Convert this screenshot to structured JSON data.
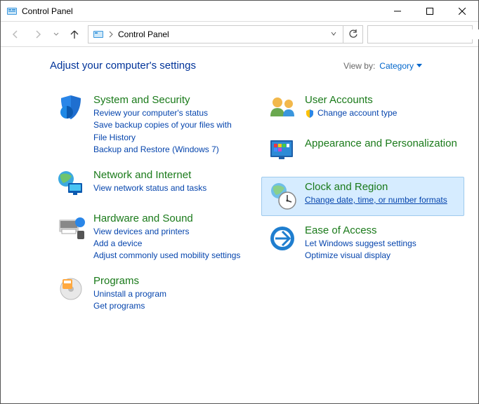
{
  "window": {
    "title": "Control Panel"
  },
  "addressbar": {
    "text": "Control Panel"
  },
  "search": {
    "placeholder": ""
  },
  "header": {
    "title": "Adjust your computer's settings",
    "viewby_label": "View by:",
    "viewby_value": "Category"
  },
  "left": {
    "system": {
      "title": "System and Security",
      "subs": [
        "Review your computer's status",
        "Save backup copies of your files with File History",
        "Backup and Restore (Windows 7)"
      ]
    },
    "network": {
      "title": "Network and Internet",
      "subs": [
        "View network status and tasks"
      ]
    },
    "hardware": {
      "title": "Hardware and Sound",
      "subs": [
        "View devices and printers",
        "Add a device",
        "Adjust commonly used mobility settings"
      ]
    },
    "programs": {
      "title": "Programs",
      "subs": [
        "Uninstall a program",
        "Get programs"
      ]
    }
  },
  "right": {
    "users": {
      "title": "User Accounts",
      "subs": [
        "Change account type"
      ]
    },
    "appearance": {
      "title": "Appearance and Personalization",
      "subs": []
    },
    "clock": {
      "title": "Clock and Region",
      "subs": [
        "Change date, time, or number formats"
      ]
    },
    "ease": {
      "title": "Ease of Access",
      "subs": [
        "Let Windows suggest settings",
        "Optimize visual display"
      ]
    }
  }
}
